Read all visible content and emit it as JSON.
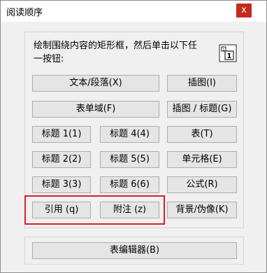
{
  "window": {
    "title": "阅读顺序",
    "close_label": "x"
  },
  "instruction": "绘制围绕内容的矩形框，然后单击以下任一按钮:",
  "order_icon": {
    "name": "reading-order-icon",
    "text": "1"
  },
  "buttons": {
    "text_paragraph": "文本/段落(X)",
    "figure": "插图(I)",
    "form_field": "表单域(F)",
    "figure_caption": "插图 / 标题(G)",
    "heading1": "标题 1(1)",
    "heading4": "标题 4(4)",
    "table": "表(T)",
    "heading2": "标题 2(2)",
    "heading5": "标题 5(5)",
    "cell": "单元格(E)",
    "heading3": "标题 3(3)",
    "heading6": "标题 6(6)",
    "formula": "公式(R)",
    "reference": "引用 (q)",
    "note": "附注 (z)",
    "background": "背景/伪像(K)",
    "table_editor": "表编辑器(B)"
  },
  "accent": {
    "highlight": "#d92027",
    "close": "#c42b1c"
  }
}
